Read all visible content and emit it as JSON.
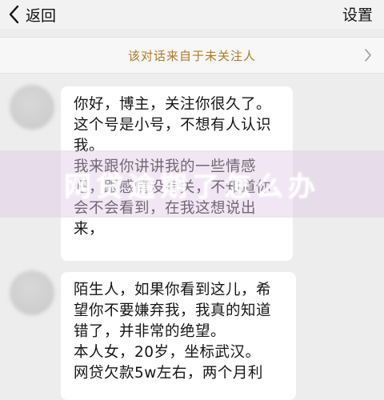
{
  "header": {
    "back_label": "返回",
    "settings_label": "设置"
  },
  "notice": {
    "text": "该对话来自于未关注人"
  },
  "messages": [
    {
      "lines": [
        "你好，博主，关注你很久了。",
        "这个号是小号，不想有人认识",
        "我。",
        "我来跟你讲讲我的一些情感",
        "吧，跟感情没有关，不知道你",
        "会不会看到，在我这想说出",
        "来，"
      ]
    },
    {
      "lines": [
        "陌生人，如果你看到这儿，希",
        "望你不要嫌弃我，我真的知道",
        "错了，并非常的绝望。",
        "本人女，20岁，坐标武汉。",
        "网贷欠款5w左右，两个月利"
      ]
    }
  ],
  "watermark": {
    "text": "网贷逾期了怎么办"
  },
  "icons": {
    "back": "chevron-left-icon",
    "notice_arrow": "chevron-right-icon"
  },
  "colors": {
    "notice_text": "#b07a2a",
    "background": "#ededed",
    "bubble": "#ffffff"
  }
}
